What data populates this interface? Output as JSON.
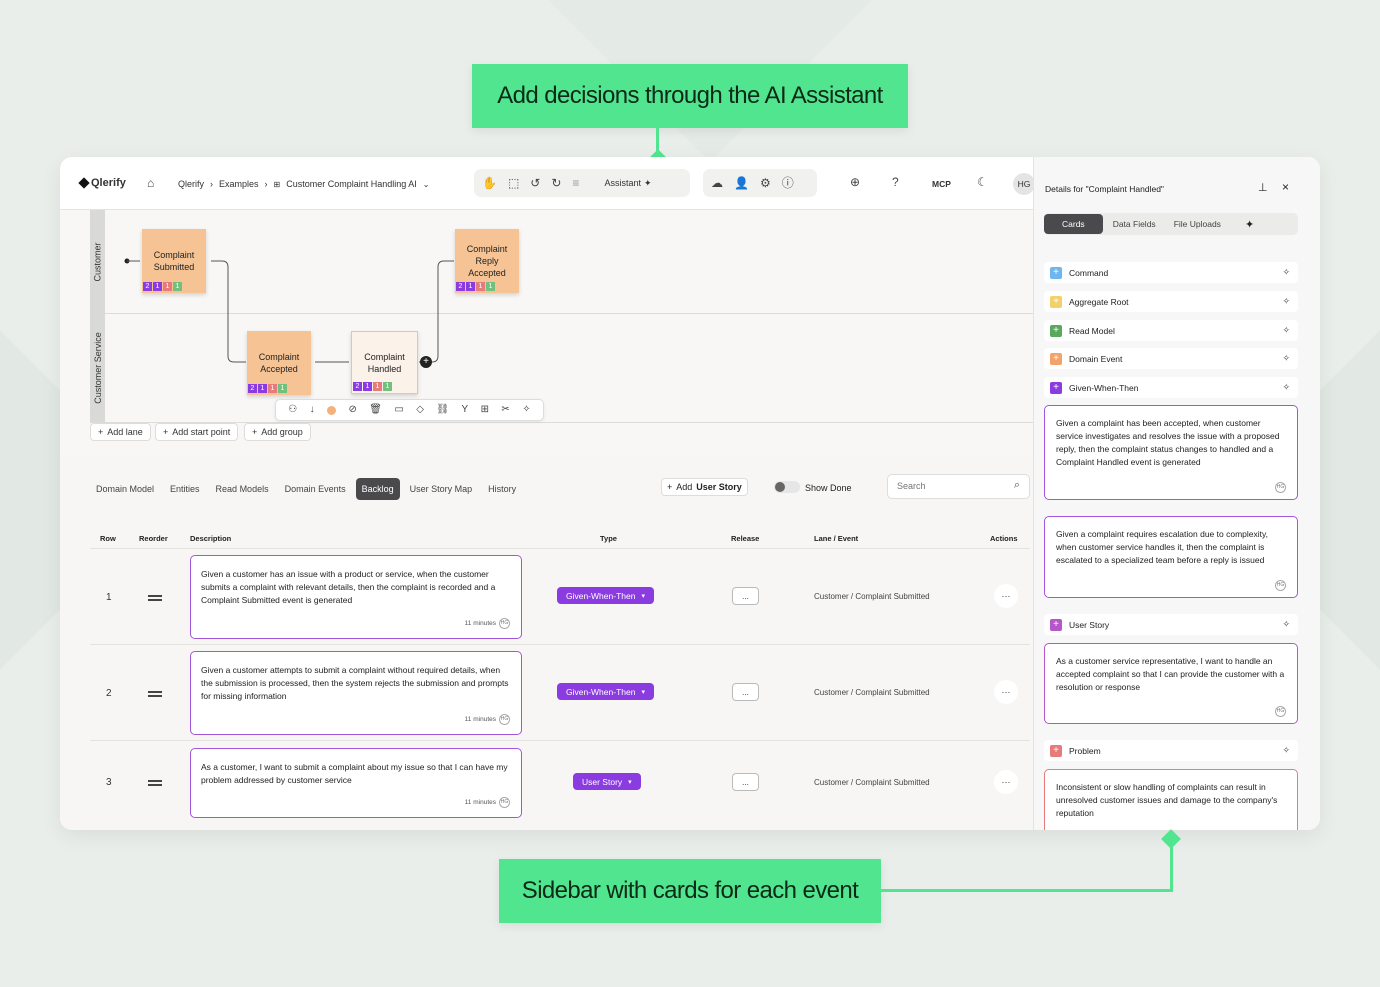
{
  "callouts": {
    "top": "Add decisions through the AI Assistant",
    "bottom": "Sidebar with cards for each event"
  },
  "colors": {
    "accent_green": "#52e58f",
    "purple": "#8a3ce0",
    "event_orange": "#f6c394"
  },
  "topbar": {
    "logo": "Qlerify",
    "breadcrumb": [
      "Qlerify",
      "Examples",
      "Customer Complaint Handling AI"
    ],
    "assistant": "Assistant",
    "mcp": "MCP",
    "avatar": "HG",
    "icons": [
      "home-icon",
      "hand-icon",
      "select-icon",
      "undo-icon",
      "redo-icon",
      "filter-icon",
      "sparkle-icon",
      "cloud-icon",
      "users-icon",
      "gear-icon",
      "info-icon",
      "plus-circle-icon",
      "help-icon",
      "moon-icon"
    ]
  },
  "canvas": {
    "lanes": [
      "Customer",
      "Customer Service"
    ],
    "events": [
      {
        "label": "Complaint Submitted",
        "badges": [
          "2",
          "1",
          "1",
          "1"
        ]
      },
      {
        "label": "Complaint Reply Accepted",
        "badges": [
          "2",
          "1",
          "1",
          "1"
        ]
      },
      {
        "label": "Complaint Accepted",
        "badges": [
          "2",
          "1",
          "1",
          "1"
        ]
      },
      {
        "label": "Complaint Handled",
        "badges": [
          "2",
          "1",
          "1",
          "1"
        ]
      }
    ],
    "buttons": [
      "Add lane",
      "Add start point",
      "Add group"
    ]
  },
  "tabs": [
    "Domain Model",
    "Entities",
    "Read Models",
    "Domain Events",
    "Backlog",
    "User Story Map",
    "History"
  ],
  "active_tab": "Backlog",
  "backlog": {
    "add_story_prefix": "Add",
    "add_story_bold": "User Story",
    "show_done": "Show Done",
    "search_placeholder": "Search",
    "columns": [
      "Row",
      "Reorder",
      "Description",
      "Type",
      "Release",
      "Lane / Event",
      "Actions"
    ],
    "rows": [
      {
        "num": "1",
        "description": "Given a customer has an issue with a product or service, when the customer submits a complaint with relevant details, then the complaint is recorded and a Complaint Submitted event is generated",
        "time": "11 minutes",
        "type": "Given-When-Then",
        "release": "...",
        "lane_event": "Customer / Complaint Submitted",
        "actions": "···"
      },
      {
        "num": "2",
        "description": "Given a customer attempts to submit a complaint without required details, when the submission is processed, then the system rejects the submission and prompts for missing information",
        "time": "11 minutes",
        "type": "Given-When-Then",
        "release": "...",
        "lane_event": "Customer / Complaint Submitted",
        "actions": "···"
      },
      {
        "num": "3",
        "description": "As a customer, I want to submit a complaint about my issue so that I can have my problem addressed by customer service",
        "time": "11 minutes",
        "type": "User Story",
        "release": "...",
        "lane_event": "Customer / Complaint Submitted",
        "actions": "···"
      }
    ]
  },
  "sidebar": {
    "title": "Details for \"Complaint Handled\"",
    "tabs": [
      "Cards",
      "Data Fields",
      "File Uploads"
    ],
    "items": [
      {
        "label": "Command",
        "color": "#6fb6ef"
      },
      {
        "label": "Aggregate Root",
        "color": "#f5d067"
      },
      {
        "label": "Read Model",
        "color": "#5aa85e"
      },
      {
        "label": "Domain Event",
        "color": "#f2a36a"
      },
      {
        "label": "Given-When-Then",
        "color": "#8a3ce0"
      },
      {
        "label": "User Story",
        "color": "#b656c9"
      },
      {
        "label": "Problem",
        "color": "#e77a7a"
      }
    ],
    "cards": [
      "Given a complaint has been accepted, when customer service investigates and resolves the issue with a proposed reply, then the complaint status changes to handled and a Complaint Handled event is generated",
      "Given a complaint requires escalation due to complexity, when customer service handles it, then the complaint is escalated to a specialized team before a reply is issued",
      "As a customer service representative, I want to handle an accepted complaint so that I can provide the customer with a resolution or response",
      "Inconsistent or slow handling of complaints can result in unresolved customer issues and damage to the company's reputation"
    ],
    "avatar": "HG"
  }
}
